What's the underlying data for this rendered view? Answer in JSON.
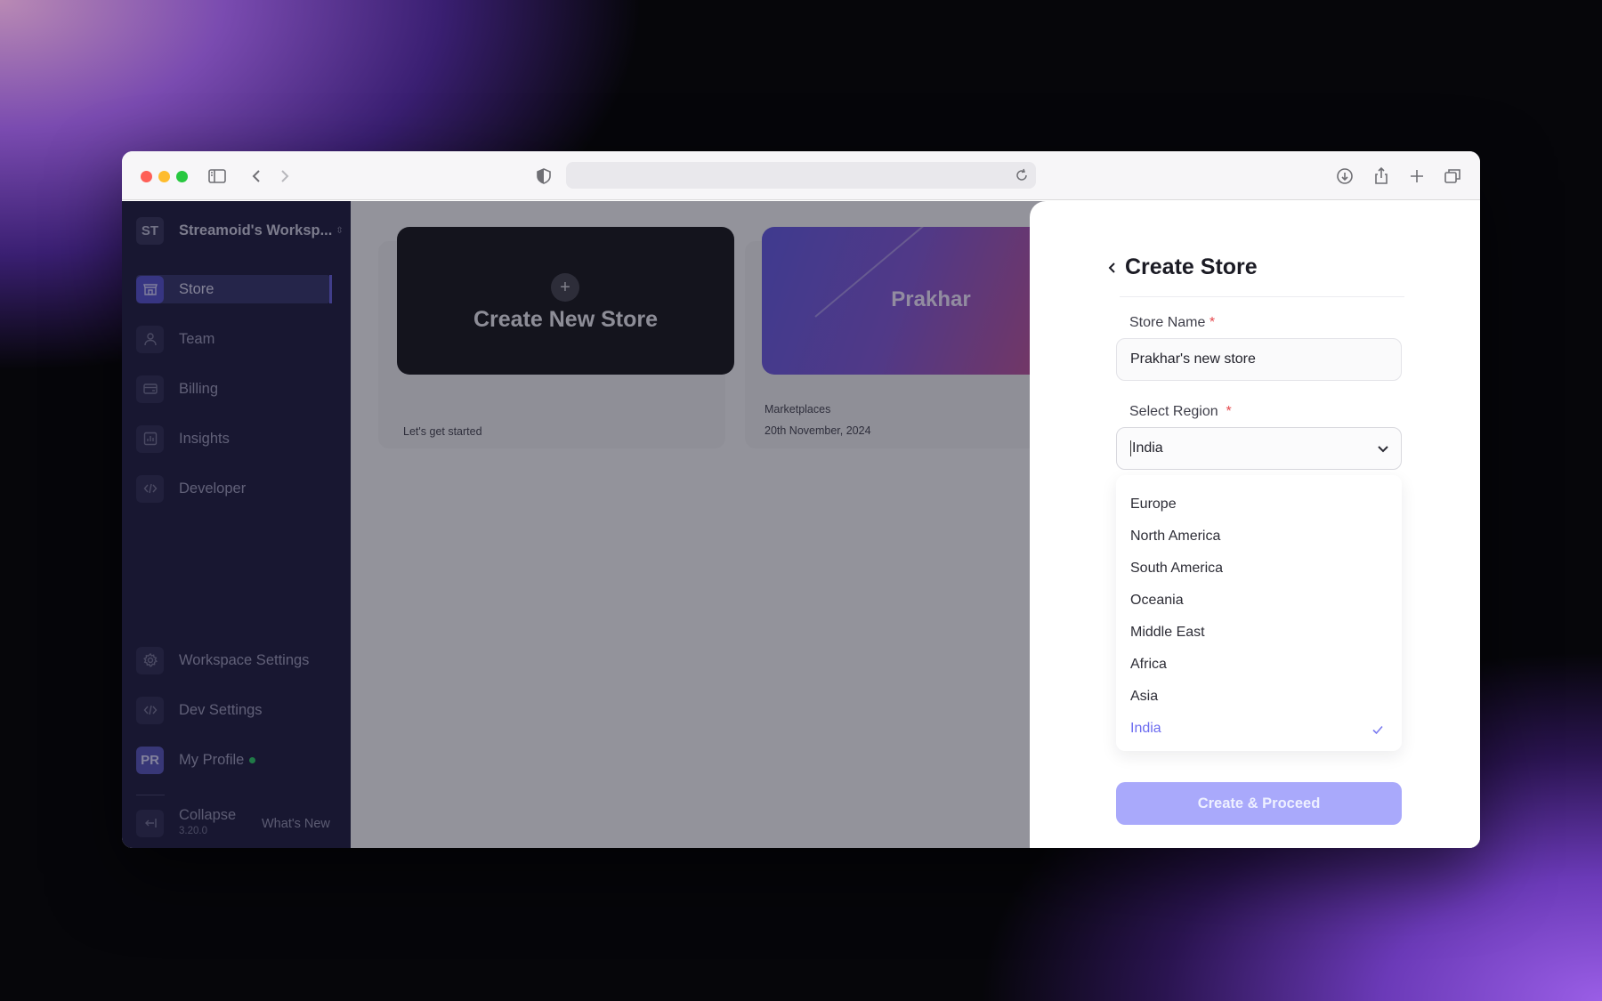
{
  "sidebar": {
    "workspace_badge": "ST",
    "workspace_name": "Streamoid's Worksp...",
    "items": [
      {
        "label": "Store",
        "icon": "store-icon",
        "active": true
      },
      {
        "label": "Team",
        "icon": "team-icon",
        "active": false
      },
      {
        "label": "Billing",
        "icon": "billing-icon",
        "active": false
      },
      {
        "label": "Insights",
        "icon": "insights-icon",
        "active": false
      },
      {
        "label": "Developer",
        "icon": "developer-icon",
        "active": false
      }
    ],
    "bottom_items": [
      {
        "label": "Workspace Settings",
        "icon": "gear-icon"
      },
      {
        "label": "Dev Settings",
        "icon": "code-icon"
      },
      {
        "label": "My Profile",
        "badge": "PR"
      }
    ],
    "collapse_label": "Collapse",
    "version": "3.20.0",
    "whats_new": "What's New"
  },
  "main": {
    "cards": [
      {
        "title": "Create New Store",
        "subtitle": "Let's get started"
      },
      {
        "title": "Prakhar",
        "line1": "Marketplaces",
        "line2": "20th November, 2024"
      }
    ]
  },
  "panel": {
    "title": "Create Store",
    "store_name_label": "Store Name",
    "required_mark": "*",
    "store_name_value": "Prakhar's new store",
    "region_label": "Select Region",
    "region_value": "India",
    "region_options": [
      "Europe",
      "North America",
      "South America",
      "Oceania",
      "Middle East",
      "Africa",
      "Asia",
      "India"
    ],
    "selected_option": "India",
    "submit_label": "Create & Proceed"
  },
  "colors": {
    "sidebar_bg": "#131236",
    "accent": "#4b47c9",
    "button": "#a9a9fb",
    "selected_option": "#6c6cf0"
  }
}
